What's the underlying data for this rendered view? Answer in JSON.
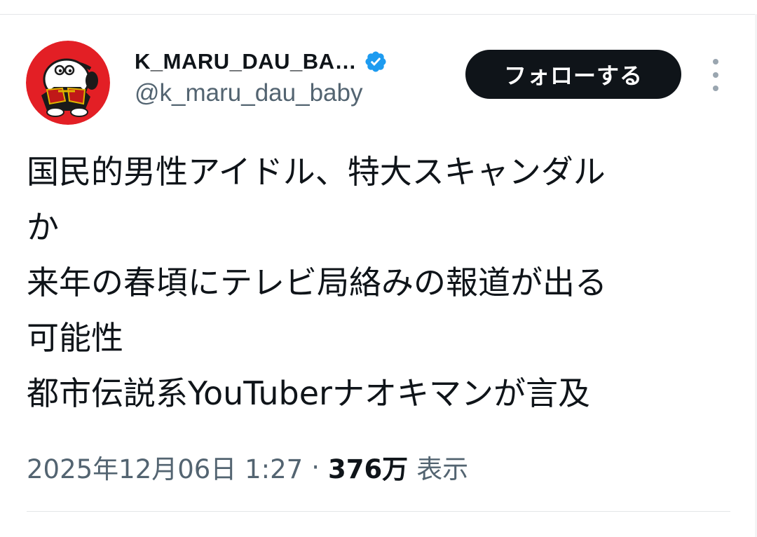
{
  "tweet": {
    "author": {
      "display_name": "K_MARU_DAU_BA…",
      "handle": "@k_maru_dau_baby",
      "verified": true,
      "avatar_icon": "cartoon-mascot-avatar-icon",
      "avatar_bg": "#e31f25"
    },
    "follow_label": "フォローする",
    "more_icon": "vertical-ellipsis-icon",
    "text_lines": [
      "国民的男性アイドル、特大スキャンダル",
      "か",
      "来年の春頃にテレビ局絡みの報道が出る",
      "可能性",
      "都市伝説系YouTuberナオキマンが言及"
    ],
    "timestamp": "2025年12月06日 1:27",
    "separator": "·",
    "views_count": "376万",
    "views_label": "表示"
  },
  "colors": {
    "text_primary": "#0f1419",
    "text_secondary": "#536471",
    "verified_blue": "#1d9bf0",
    "button_bg": "#0f1419",
    "divider": "#e4e6e8"
  }
}
